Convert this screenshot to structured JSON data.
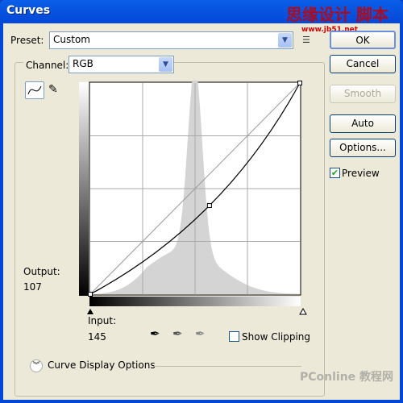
{
  "window": {
    "title": "Curves"
  },
  "preset": {
    "label": "Preset:",
    "value": "Custom"
  },
  "channel": {
    "label": "Channel:",
    "value": "RGB"
  },
  "buttons": {
    "ok": "OK",
    "cancel": "Cancel",
    "smooth": "Smooth",
    "auto": "Auto",
    "options": "Options..."
  },
  "preview": {
    "label": "Preview",
    "checked": true
  },
  "output": {
    "label": "Output:",
    "value": "107"
  },
  "input": {
    "label": "Input:",
    "value": "145"
  },
  "show_clipping": {
    "label": "Show Clipping",
    "checked": false
  },
  "curve_display_options": "Curve Display Options",
  "curve": {
    "points": [
      [
        0,
        0
      ],
      [
        145,
        107
      ],
      [
        255,
        255
      ]
    ]
  },
  "watermarks": {
    "top": "思缘设计 脚本之家",
    "top_url": "www.jb51.net",
    "bottom": "PConline 教程网"
  }
}
